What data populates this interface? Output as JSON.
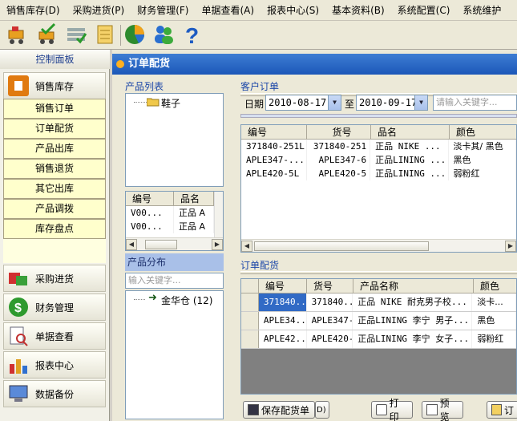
{
  "menu": [
    "销售库存(D)",
    "采购进货(P)",
    "财务管理(F)",
    "单据查看(A)",
    "报表中心(S)",
    "基本资料(B)",
    "系统配置(C)",
    "系统维护"
  ],
  "toolbar": {
    "icons": [
      "cart-icon",
      "cart-check-icon",
      "list-icon",
      "notebook-icon",
      "pie-chart-icon",
      "users-icon",
      "help-icon"
    ]
  },
  "left": {
    "title": "控制面板",
    "active_section": "销售库存",
    "items": [
      "销售订单",
      "订单配货",
      "产品出库",
      "销售退货",
      "其它出库",
      "产品调拨",
      "库存盘点"
    ],
    "sections": [
      "采购进货",
      "财务管理",
      "单据查看",
      "报表中心",
      "数据备份"
    ]
  },
  "main": {
    "title": "订单配货",
    "product_list": {
      "label": "产品列表",
      "tree_node": "鞋子",
      "headers": [
        "编号",
        "品名"
      ],
      "rows": [
        [
          "V00...",
          "正品 A"
        ],
        [
          "V00...",
          "正品 A"
        ]
      ]
    },
    "distribution": {
      "label": "产品分布",
      "placeholder": "输入关键字...",
      "node": "金华仓 (12)"
    },
    "customer_orders": {
      "label": "客户订单",
      "date_label": "日期",
      "date_from": "2010-08-17",
      "to_label": "至",
      "date_to": "2010-09-17",
      "search_placeholder": "请输入关键字...",
      "headers": [
        "编号",
        "货号",
        "品名",
        "颜色"
      ],
      "rows": [
        [
          "371840-251L",
          "371840-251",
          "正品 NIKE ...",
          "淡卡其/ 黑色"
        ],
        [
          "APLE347-...",
          "APLE347-6",
          "正品LINING ...",
          "黑色"
        ],
        [
          "APLE420-5L",
          "APLE420-5",
          "正品LINING ...",
          "弱粉红"
        ]
      ]
    },
    "allocation": {
      "label": "订单配货",
      "headers": [
        "编号",
        "货号",
        "产品名称",
        "颜色"
      ],
      "rows": [
        [
          "371840...",
          "371840...",
          "正品 NIKE 耐克男子校...",
          "淡卡..."
        ],
        [
          "APLE34...",
          "APLE347-6",
          "正品LINING 李宁 男子...",
          "黑色"
        ],
        [
          "APLE42...",
          "APLE420-5",
          "正品LINING 李宁 女子...",
          "弱粉红"
        ]
      ]
    },
    "buttons": {
      "save": "保存配货单",
      "hotkey": "D)",
      "print": "打印",
      "preview": "预览",
      "order": "订"
    }
  }
}
